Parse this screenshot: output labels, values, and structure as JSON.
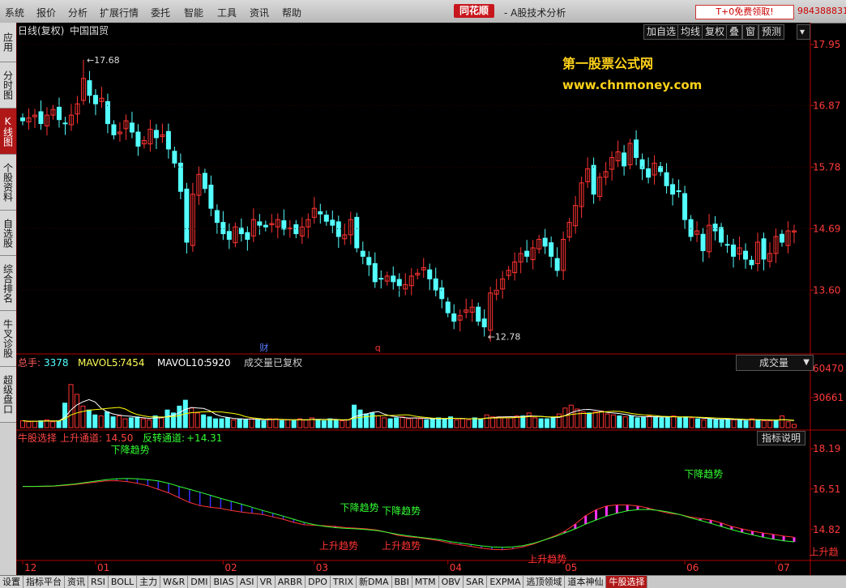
{
  "menu": [
    "系统",
    "报价",
    "分析",
    "扩展行情",
    "委托",
    "智能",
    "工具",
    "资讯",
    "帮助"
  ],
  "brand": "同花顺",
  "app_title": "- A股技术分析",
  "promo": "T+0免费领取!",
  "phone": "984388831",
  "sidebar": [
    "应用",
    "分时图",
    "K线图",
    "个股资料",
    "自选股",
    "综合排名",
    "牛叉诊股",
    "超级盘口"
  ],
  "sidebar_active": 2,
  "toolbar": [
    "加自选",
    "均线",
    "复权",
    "叠",
    "窗",
    "预测"
  ],
  "watermark": {
    "line1": "第一股票公式网",
    "line2": "www.chnmoney.com"
  },
  "bottom_tabs": [
    "设置",
    "指标平台",
    "资讯",
    "RSI",
    "BOLL",
    "主力",
    "W&R",
    "DMI",
    "BIAS",
    "ASI",
    "VR",
    "ARBR",
    "DPO",
    "TRIX",
    "新DMA",
    "BBI",
    "MTM",
    "OBV",
    "SAR",
    "EXPMA",
    "逃顶领域",
    "道本神仙",
    "牛股选择"
  ],
  "bottom_active": 22,
  "colors": {
    "up": "#ff3333",
    "down": "#54ffff",
    "axis": "#b00000",
    "ma5": "#ffffff",
    "ma10": "#ffff00",
    "green": "#33ff33",
    "magenta": "#ff33ff",
    "blue": "#3030ff"
  },
  "chart_data": {
    "price_panel": {
      "type": "candlestick",
      "title": "日线(复权)",
      "stock": "中国国贸",
      "y_ticks": [
        "17.95",
        "16.87",
        "15.78",
        "14.69",
        "13.60"
      ],
      "ylim": [
        12.6,
        18.05
      ],
      "high_marker": "17.68",
      "low_marker": "12.78",
      "event_marks": [
        "财",
        "q"
      ],
      "x_ticks": [
        "12",
        "01",
        "02",
        "03",
        "04",
        "05",
        "06",
        "07"
      ],
      "closes": [
        16.6,
        16.65,
        16.7,
        16.55,
        16.7,
        16.8,
        16.62,
        16.55,
        16.7,
        16.9,
        17.35,
        17.05,
        16.9,
        17.0,
        16.55,
        16.35,
        16.4,
        16.6,
        16.4,
        16.15,
        16.25,
        16.45,
        16.3,
        16.35,
        16.1,
        15.85,
        15.35,
        14.45,
        15.3,
        15.65,
        15.4,
        15.05,
        14.8,
        14.6,
        14.5,
        14.72,
        14.6,
        14.5,
        14.85,
        14.75,
        14.72,
        14.78,
        14.85,
        14.68,
        14.7,
        14.6,
        14.72,
        14.85,
        15.05,
        14.95,
        14.82,
        14.75,
        14.55,
        14.58,
        14.85,
        14.35,
        14.2,
        14.05,
        13.75,
        13.8,
        13.85,
        13.75,
        13.68,
        13.7,
        13.85,
        13.9,
        14.0,
        13.8,
        13.6,
        13.45,
        13.2,
        13.05,
        13.15,
        13.25,
        13.3,
        13.05,
        12.95,
        13.55,
        13.6,
        13.8,
        13.95,
        14.1,
        14.25,
        14.2,
        14.35,
        14.5,
        14.38,
        14.2,
        13.95,
        14.5,
        14.8,
        15.1,
        15.5,
        15.75,
        15.3,
        15.6,
        15.7,
        15.95,
        16.05,
        15.8,
        16.2,
        15.95,
        15.75,
        15.6,
        15.85,
        15.7,
        15.45,
        15.3,
        15.35,
        14.85,
        14.55,
        14.65,
        14.3,
        14.75,
        14.65,
        14.45,
        14.4,
        14.2,
        14.35,
        14.15,
        14.05,
        14.45,
        14.15,
        14.25,
        14.55,
        14.45,
        14.65,
        14.65
      ],
      "opens_delta_note": "",
      "series": [
        {
          "name": "MA5"
        },
        {
          "name": "MA10"
        }
      ]
    },
    "volume_panel": {
      "type": "bar",
      "label_total": "总手:",
      "total": "3378",
      "ma5_label": "MAVOL5:",
      "ma5": "7454",
      "ma10_label": "MAVOL10:",
      "ma10": "5920",
      "note": "成交量已复权",
      "selector": "成交量",
      "y_ticks": [
        "60470",
        "30661"
      ],
      "ylim": [
        0,
        62000
      ],
      "values": [
        7000,
        6000,
        6500,
        7000,
        8000,
        6000,
        7000,
        25000,
        44000,
        34000,
        22000,
        18000,
        13000,
        12000,
        16000,
        11000,
        12000,
        9000,
        10000,
        11000,
        9000,
        8000,
        12000,
        10000,
        18000,
        15000,
        22000,
        28000,
        20000,
        15000,
        13000,
        11000,
        9000,
        9000,
        10000,
        8000,
        9000,
        8000,
        9000,
        8000,
        7000,
        9000,
        9000,
        7000,
        8000,
        7000,
        9000,
        8000,
        10000,
        8000,
        7000,
        9000,
        8000,
        7000,
        8000,
        23000,
        18000,
        14000,
        15000,
        12000,
        10000,
        9000,
        10000,
        11000,
        9000,
        10000,
        9000,
        8000,
        9000,
        10000,
        9000,
        11000,
        8000,
        9000,
        8000,
        10000,
        9000,
        13000,
        11000,
        11000,
        11000,
        10000,
        12000,
        12000,
        15000,
        10000,
        9000,
        9000,
        10000,
        14000,
        20000,
        23000,
        19000,
        16000,
        15000,
        16000,
        17000,
        14000,
        13000,
        12000,
        11000,
        12000,
        10000,
        11000,
        12000,
        11000,
        10000,
        11000,
        12000,
        10000,
        11000,
        10000,
        9000,
        8000,
        9000,
        8000,
        8000,
        9000,
        8000,
        8000,
        7000,
        9000,
        8000,
        7000,
        7000,
        7000,
        12000,
        6000,
        3378
      ]
    },
    "indicator_panel": {
      "type": "line",
      "title": "牛股选择",
      "series_labels": [
        "上升通道:",
        "反转通道:"
      ],
      "series_values": [
        "14.50",
        "+14.31"
      ],
      "help_button": "指标说明",
      "y_ticks": [
        "18.19",
        "16.51",
        "14.82"
      ],
      "ylim": [
        13.6,
        18.8
      ],
      "up_channel": [
        16.62,
        16.62,
        16.62,
        16.63,
        16.66,
        16.7,
        16.75,
        16.8,
        16.85,
        16.86,
        16.82,
        16.75,
        16.65,
        16.5,
        16.35,
        16.15,
        15.95,
        15.82,
        15.75,
        15.7,
        15.62,
        15.55,
        15.5,
        15.45,
        15.35,
        15.25,
        15.12,
        15.02,
        15.0,
        14.98,
        14.95,
        14.9,
        14.88,
        14.85,
        14.8,
        14.7,
        14.58,
        14.52,
        14.48,
        14.42,
        14.35,
        14.25,
        14.18,
        14.12,
        14.05,
        14.0,
        13.98,
        14.02,
        14.1,
        14.22,
        14.38,
        14.55,
        14.75,
        15.05,
        15.4,
        15.65,
        15.8,
        15.85,
        15.85,
        15.8,
        15.72,
        15.6,
        15.5,
        15.45,
        15.35,
        15.28,
        15.22,
        15.1,
        14.95,
        14.85,
        14.75,
        14.68,
        14.62,
        14.55,
        14.5
      ],
      "rev_channel": [
        16.62,
        16.62,
        16.63,
        16.64,
        16.68,
        16.72,
        16.78,
        16.84,
        16.9,
        16.94,
        16.95,
        16.94,
        16.9,
        16.85,
        16.75,
        16.62,
        16.5,
        16.38,
        16.25,
        16.12,
        16.0,
        15.88,
        15.75,
        15.62,
        15.5,
        15.38,
        15.25,
        15.12,
        15.02,
        14.95,
        14.9,
        14.87,
        14.85,
        14.82,
        14.78,
        14.7,
        14.62,
        14.56,
        14.5,
        14.45,
        14.4,
        14.32,
        14.26,
        14.2,
        14.14,
        14.1,
        14.08,
        14.1,
        14.15,
        14.25,
        14.38,
        14.52,
        14.68,
        14.85,
        15.05,
        15.22,
        15.38,
        15.5,
        15.6,
        15.65,
        15.66,
        15.62,
        15.55,
        15.45,
        15.32,
        15.2,
        15.08,
        14.95,
        14.82,
        14.7,
        14.6,
        14.5,
        14.42,
        14.35,
        14.31
      ],
      "annotations": [
        {
          "text": "下降趋势",
          "color": "green",
          "i": 10,
          "v": 18.0
        },
        {
          "text": "下降趋势",
          "color": "green",
          "i": 32,
          "v": 15.6
        },
        {
          "text": "下降趋势",
          "color": "green",
          "i": 36,
          "v": 15.45
        },
        {
          "text": "上升趋势",
          "color": "red",
          "i": 30,
          "v": 14.0
        },
        {
          "text": "上升趋势",
          "color": "red",
          "i": 36,
          "v": 14.0
        },
        {
          "text": "上升趋势",
          "color": "red",
          "i": 50,
          "v": 13.45
        },
        {
          "text": "下降趋势",
          "color": "green",
          "i": 65,
          "v": 17.0
        },
        {
          "text": "上升趋",
          "color": "red",
          "i": 77,
          "v": 13.75
        }
      ]
    }
  }
}
